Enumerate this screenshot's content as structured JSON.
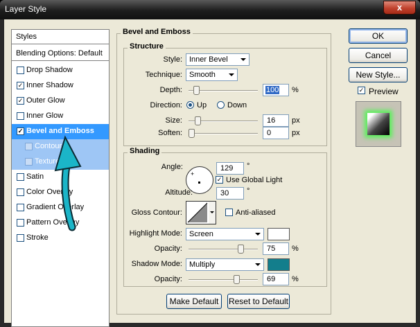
{
  "window": {
    "title": "Layer Style",
    "close_glyph": "x"
  },
  "style_list": {
    "header": "Styles",
    "blending": "Blending Options: Default",
    "items": [
      {
        "label": "Drop Shadow",
        "checked": false
      },
      {
        "label": "Inner Shadow",
        "checked": true
      },
      {
        "label": "Outer Glow",
        "checked": true
      },
      {
        "label": "Inner Glow",
        "checked": false
      },
      {
        "label": "Bevel and Emboss",
        "checked": true,
        "selected": true
      },
      {
        "label": "Contour",
        "checked": false,
        "sub": true
      },
      {
        "label": "Texture",
        "checked": false,
        "sub": true
      },
      {
        "label": "Satin",
        "checked": false
      },
      {
        "label": "Color Overlay",
        "checked": false
      },
      {
        "label": "Gradient Overlay",
        "checked": false
      },
      {
        "label": "Pattern Overlay",
        "checked": false
      },
      {
        "label": "Stroke",
        "checked": false
      }
    ]
  },
  "panel": {
    "title": "Bevel and Emboss",
    "structure": {
      "legend": "Structure",
      "style_label": "Style:",
      "style_value": "Inner Bevel",
      "technique_label": "Technique:",
      "technique_value": "Smooth",
      "depth_label": "Depth:",
      "depth_value": "100",
      "depth_unit": "%",
      "direction_label": "Direction:",
      "direction_up": "Up",
      "direction_down": "Down",
      "size_label": "Size:",
      "size_value": "16",
      "size_unit": "px",
      "soften_label": "Soften:",
      "soften_value": "0",
      "soften_unit": "px"
    },
    "shading": {
      "legend": "Shading",
      "angle_label": "Angle:",
      "angle_value": "129",
      "angle_unit": "°",
      "global_light_label": "Use Global Light",
      "global_light_checked": true,
      "altitude_label": "Altitude:",
      "altitude_value": "30",
      "altitude_unit": "°",
      "gloss_label": "Gloss Contour:",
      "anti_aliased_label": "Anti-aliased",
      "anti_aliased_checked": false,
      "highlight_label": "Highlight Mode:",
      "highlight_value": "Screen",
      "highlight_color": "#ffffff",
      "h_opacity_label": "Opacity:",
      "h_opacity_value": "75",
      "h_opacity_unit": "%",
      "shadow_label": "Shadow Mode:",
      "shadow_value": "Multiply",
      "shadow_color": "#137e8c",
      "s_opacity_label": "Opacity:",
      "s_opacity_value": "69",
      "s_opacity_unit": "%"
    },
    "make_default": "Make Default",
    "reset_default": "Reset to Default"
  },
  "buttons": {
    "ok": "OK",
    "cancel": "Cancel",
    "new_style": "New Style...",
    "preview_label": "Preview",
    "preview_checked": true
  },
  "colors": {
    "accent_selected": "#3399ff",
    "annotation_arrow": "#1bb5c8"
  }
}
